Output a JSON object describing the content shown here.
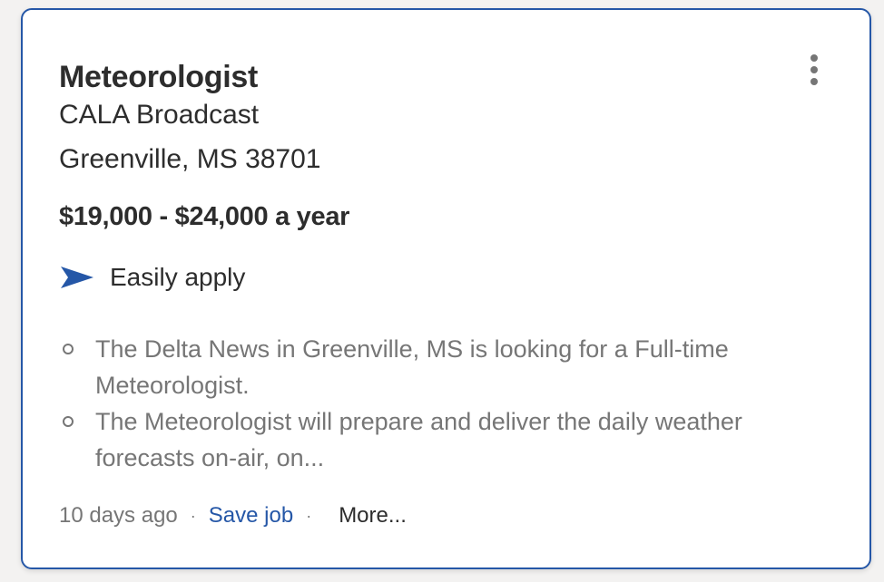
{
  "job": {
    "title": "Meteorologist",
    "company": "CALA Broadcast",
    "location": "Greenville, MS 38701",
    "salary": "$19,000 - $24,000 a year",
    "apply_label": "Easily apply",
    "snippet": [
      "The Delta News in Greenville, MS is looking for a Full-time Meteorologist.",
      "The Meteorologist will prepare and deliver the daily weather forecasts on-air, on..."
    ],
    "posted": "10 days ago",
    "separator": "·",
    "save_label": "Save job",
    "more_label": "More..."
  },
  "icons": {
    "menu": "more-vertical-icon",
    "apply": "paper-plane-arrow-icon",
    "bullet": "hollow-circle-bullet-icon"
  },
  "colors": {
    "accent": "#2557a7",
    "text_primary": "#2d2d2d",
    "text_secondary": "#767676",
    "card_border": "#2557a7"
  }
}
